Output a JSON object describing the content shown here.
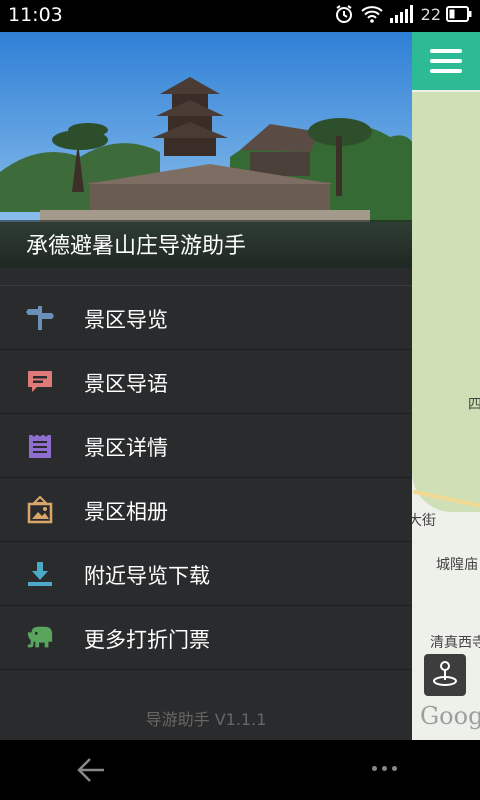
{
  "status_bar": {
    "time": "11:03",
    "battery_level": "22",
    "icons": [
      "alarm-icon",
      "wifi-icon",
      "signal-icon",
      "battery-icon"
    ]
  },
  "drawer": {
    "app_title": "承德避暑山庄导游助手",
    "menu": [
      {
        "label": "景区导览",
        "icon": "signpost-icon",
        "color": "#6a8fb8"
      },
      {
        "label": "景区导语",
        "icon": "chat-bubble-icon",
        "color": "#e07a78"
      },
      {
        "label": "景区详情",
        "icon": "notepad-icon",
        "color": "#8e6fd0"
      },
      {
        "label": "景区相册",
        "icon": "picture-frame-icon",
        "color": "#d8a66a"
      },
      {
        "label": "附近导览下载",
        "icon": "download-icon",
        "color": "#4ca9c8"
      },
      {
        "label": "更多打折门票",
        "icon": "elephant-icon",
        "color": "#5aa55e"
      }
    ],
    "version": "导游助手 V1.1.1"
  },
  "map": {
    "labels": {
      "label_1": "四",
      "label_2": "大街",
      "label_3": "城隍庙",
      "label_4": "清真西寺"
    },
    "logo": "Goog",
    "menu_button_color": "#2dbb93"
  },
  "nav_bar": {
    "icons": [
      "back-arrow-icon",
      "more-dots-icon"
    ]
  }
}
